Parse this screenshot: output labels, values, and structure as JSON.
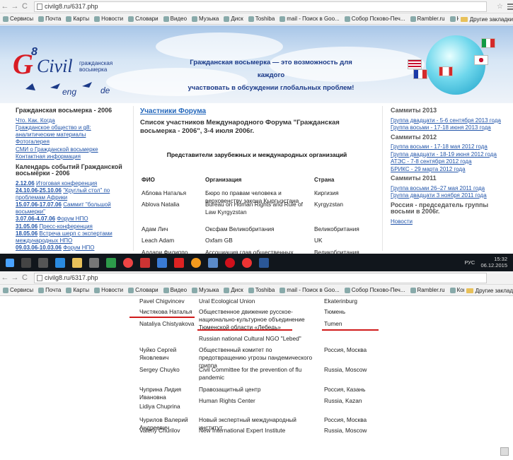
{
  "browser": {
    "url": "civilg8.ru/6317.php",
    "bookmarks": [
      "Сервисы",
      "Почта",
      "Карты",
      "Новости",
      "Словари",
      "Видео",
      "Музыка",
      "Диск",
      "Toshiba",
      "mail - Поиск в Goo...",
      "Собор Псково-Печ...",
      "Rambler.ru",
      "Константин Яросла..."
    ],
    "other_bookmarks": "Другие закладки",
    "other_bookmarks_short": "Другие заклад"
  },
  "banner": {
    "logo_civil": "Civil",
    "logo_8": "8",
    "logo_sub1": "гражданская",
    "logo_sub2": "восьмерка",
    "logo_eng": "eng",
    "logo_de": "de",
    "tagline1": "Гражданская восьмерка — это возможность для каждого",
    "tagline2": "участвовать в обсуждении глобальных проблем!"
  },
  "left": {
    "h1": "Гражданская восьмерка - 2006",
    "links": [
      "Что. Как. Когда",
      "Гражданское общество и g8: аналитические материалы",
      "Фотогалерея",
      "СМИ о Гражданской восьмерке",
      "Контактная информация"
    ],
    "h2": "Календарь событий Гражданской восьмёрки - 2006",
    "events": [
      {
        "date": "2.12.06",
        "text": "Итоговая конференция"
      },
      {
        "date": "24.10.06-25.10.06",
        "text": "\"Круглый стол\" по проблемам Африки"
      },
      {
        "date": "15.07.06-17.07.06",
        "text": "Саммит \"большой восьмерки\""
      },
      {
        "date": "3.07.06-4.07.06",
        "text": "Форум НПО"
      },
      {
        "date": "31.05.06",
        "text": "Пресс-конференция"
      },
      {
        "date": "18.05.06",
        "text": "Встреча шерп с экспертами международных НПО"
      },
      {
        "date": "09.03.06-10.03.06",
        "text": "Форум НПО"
      }
    ]
  },
  "center": {
    "title": "Участники Форума",
    "subtitle": "Список участников Международного Форума \"Гражданская восьмерка - 2006\", 3-4 июля 2006г.",
    "section": "Представители зарубежных и международных организаций",
    "col_fio": "ФИО",
    "col_org": "Организация",
    "col_country": "Страна",
    "rows": [
      {
        "fio": "Аблова Наталья",
        "org": "Бюро по правам человека и верховенству закона Кыргызстана",
        "country": "Киргизия"
      },
      {
        "fio": "Ablova Natalia",
        "org": "Bureau on Human Rights and Rule of Law Kyrgyzstan",
        "country": "Kyrgyzstan"
      },
      {
        "fio": "Адам Лич",
        "org": "Оксфам Великобритания",
        "country": "Великобритания"
      },
      {
        "fio": "Leach Adam",
        "org": "Oxfam GB",
        "country": "UK"
      },
      {
        "fio": "Аддари Филиппо",
        "org": "Ассоциация глав общественных",
        "country": "Великобритания"
      }
    ]
  },
  "right": {
    "h1": "Саммиты 2013",
    "l1": [
      "Группа двадцати - 5-6 сентября 2013 года",
      "Группа восьми - 17-18 июня 2013 года"
    ],
    "h2": "Саммиты 2012",
    "l2": [
      "Группа восьми - 17-18 мая 2012 года",
      "Группа двадцати - 18-19 июня 2012 года",
      "АТЭС - 7-8 сентября 2012 года",
      "БРИКС - 29 марта 2012 года"
    ],
    "h3": "Саммиты 2011",
    "l3": [
      "Группа восьми 26–27 мая 2011 года",
      "Группа двадцати 3 ноября 2011 года"
    ],
    "h4": "Россия - председатель группы восьми в 2006г.",
    "l4": [
      "Новости"
    ]
  },
  "taskbar": {
    "lang": "РУС",
    "time": "15:32",
    "date": "06.12.2015"
  },
  "lower": {
    "rows": [
      {
        "fio": "Pavel Chigvincev",
        "org": "Ural Ecological Union",
        "country": "Ekaterinburg"
      },
      {
        "fio": "Чистякова Наталья",
        "org": "Общественное движение русское-национально-культурное объединение Тюменской области «Лебедь»",
        "country": "Тюмень"
      },
      {
        "fio": "Nataliya Chistyakova",
        "org": "",
        "country": "Tumen"
      },
      {
        "fio": "",
        "org": "Russian national Cultural NGO \"Lebed\"",
        "country": ""
      },
      {
        "fio": "Чуйко Сергей Яковлевич",
        "org": "Общественный комитет по предотвращению угрозы пандемического гриппа",
        "country": "Россия, Москва"
      },
      {
        "fio": "Sergey Chuyko",
        "org": "Civil Committee for the prevention of flu pandemic",
        "country": "Russia, Moscow"
      },
      {
        "fio": "Чуприна Лидия Ивановна",
        "org": "Правозащитный центр",
        "country": "Россия, Казань"
      },
      {
        "fio": "Lidiya Chuprina",
        "org": "Human Rights Center",
        "country": "Russia, Kazan"
      },
      {
        "fio": "Чурилов Валерий Андреевич",
        "org": "Новый экспертный международный институт",
        "country": "Россия, Москва"
      },
      {
        "fio": "Valeriy Churilov",
        "org": "New International Expert Institute",
        "country": "Russia, Moscow"
      }
    ]
  }
}
